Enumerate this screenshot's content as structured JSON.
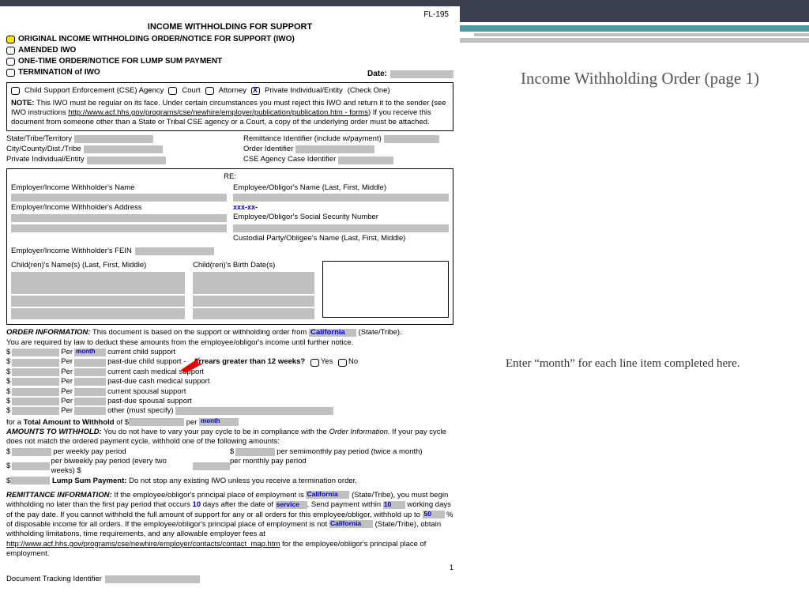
{
  "sidebar": {
    "title": "Income Withholding Order (page 1)",
    "note": "Enter “month” for each line item completed here."
  },
  "form": {
    "code": "FL-195",
    "title": "INCOME WITHHOLDING FOR SUPPORT",
    "options": {
      "original": "ORIGINAL INCOME WITHHOLDING ORDER/NOTICE FOR SUPPORT (IWO)",
      "amended": "AMENDED IWO",
      "onetime": "ONE-TIME ORDER/NOTICE FOR LUMP SUM PAYMENT",
      "termination": "TERMINATION of IWO"
    },
    "date_label": "Date:",
    "sender": {
      "cse": "Child Support Enforcement (CSE) Agency",
      "court": "Court",
      "attorney": "Attorney",
      "priv": "Private Individual/Entity",
      "check_one": "(Check One)"
    },
    "note": {
      "prefix": "NOTE:",
      "body1": "This IWO must be regular on its face. Under certain circumstances you must reject this IWO and return it to the sender (see IWO instructions ",
      "link1": "http://www.acf.hhs.gov/programs/cse/newhire/employer/publication/publication.htm - forms",
      "body2": ") If you receive this document from someone other than a State or Tribal CSE agency or a Court, a copy of the underlying order must be attached."
    },
    "ids": {
      "state": "State/Tribe/Territory",
      "city": "City/County/Dist./Tribe",
      "priv": "Private Individual/Entity",
      "remit": "Remittance Identifier (include w/payment)",
      "order": "Order Identifier",
      "cse": "CSE Agency Case Identifier"
    },
    "parties": {
      "re": "RE:",
      "emp_name": "Employer/Income Withholder's Name",
      "emp_addr": "Employer/Income Withholder's Address",
      "obl_name": "Employee/Obligor's Name (Last, First, Middle)",
      "ssn_mask": "xxx-xx-",
      "obl_ssn": "Employee/Obligor's Social Security Number",
      "cust": "Custodial Party/Obligee's Name (Last, First, Middle)",
      "fein": "Employer/Income Withholder's FEIN",
      "child_names": "Child(ren)'s Name(s) (Last, First, Middle)",
      "child_dob": "Child(ren)'s Birth Date(s)"
    },
    "order": {
      "heading": "ORDER INFORMATION:",
      "body1": "This document is based on the support or withholding order from",
      "state": "California",
      "state_tribe": "(State/Tribe).",
      "body2": "You are required by law to deduct these amounts from the employee/obligor's income until further notice.",
      "per": "Per",
      "month": "month",
      "items": [
        "current child support",
        "past-due child support -",
        "current cash medical support",
        "past-due cash medical support",
        "current spousal support",
        "past-due spousal support",
        "other (must specify)"
      ],
      "arrears_q": "Arrears greater than 12 weeks?",
      "yes": "Yes",
      "no": "No",
      "total_prefix": "for a",
      "total_bold": "Total Amount to Withhold",
      "total_of": "of $",
      "total_per": "per"
    },
    "amounts": {
      "heading": "AMOUNTS TO WITHHOLD:",
      "body": "You do not have to vary your pay cycle to be in compliance with the",
      "ital": "Order Information.",
      "body2": "If your pay cycle does not match the ordered payment cycle, withhold one of the following amounts:",
      "weekly": "per weekly pay period",
      "semimonthly": "per semimonthly pay period (twice a month)",
      "biweekly": "per biweekly pay period (every two weeks) $",
      "monthly": "per monthly pay period",
      "lump_bold": "Lump Sum Payment:",
      "lump": "Do not stop any existing IWO unless you receive a termination order."
    },
    "remit": {
      "heading": "REMITTANCE INFORMATION:",
      "b1": "If the employee/obligor's principal place of employment is",
      "state1": "California",
      "st": "(State/Tribe),",
      "b2": "you must begin withholding no later than the first pay period that occurs",
      "days": "10",
      "b3": "days after the date of",
      "service": "service",
      "b4": ". Send payment within",
      "wd": "10",
      "b5": "working days of the pay date. If you cannot withhold the full amount of support for any or all orders for this employee/obligor, withhold up to",
      "pct": "50",
      "b6": "% of disposable income for all orders. If the employee/obligor's principal place of employment is not",
      "state2": "California",
      "b7": "(State/Tribe), obtain withholding limitations, time requirements, and any allowable employer fees at",
      "link": "http://www.acf.hhs.gov/programs/cse/newhire/employer/contacts/contact_map.htm",
      "b8": "for the employee/obligor's principal place of employment."
    },
    "page": "1",
    "tracking": "Document Tracking Identifier"
  }
}
